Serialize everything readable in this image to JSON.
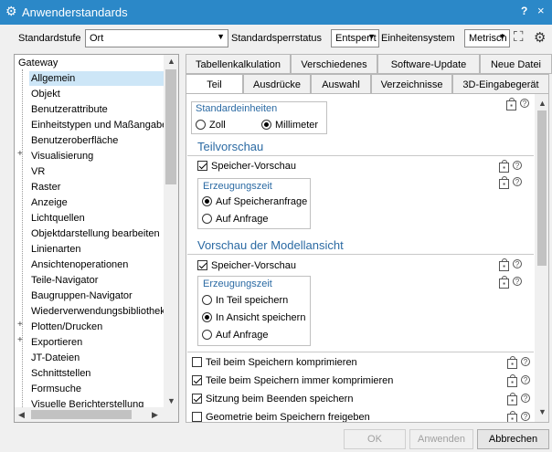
{
  "window": {
    "title": "Anwenderstandards",
    "help": "?",
    "close": "×"
  },
  "toolbar": {
    "level_label": "Standardstufe",
    "level_value": "Ort",
    "lock_label": "Standardsperrstatus",
    "lock_value": "Entsperrt",
    "units_label": "Einheitensystem",
    "units_value": "Metrisch"
  },
  "tree": {
    "items": [
      "Gateway",
      "Allgemein",
      "Objekt",
      "Benutzerattribute",
      "Einheitstypen und Maßangaber",
      "Benutzeroberfläche",
      "Visualisierung",
      "VR",
      "Raster",
      "Anzeige",
      "Lichtquellen",
      "Objektdarstellung bearbeiten",
      "Linienarten",
      "Ansichtenoperationen",
      "Teile-Navigator",
      "Baugruppen-Navigator",
      "Wiederverwendungsbibliothek",
      "Plotten/Drucken",
      "Exportieren",
      "JT-Dateien",
      "Schnittstellen",
      "Formsuche",
      "Visuelle Berichterstellung"
    ],
    "expanders": [
      "+",
      "+",
      "+"
    ]
  },
  "tabs_row1": [
    "Tabellenkalkulation",
    "Verschiedenes",
    "Software-Update",
    "Neue Datei"
  ],
  "tabs_row2": [
    "Teil",
    "Ausdrücke",
    "Auswahl",
    "Verzeichnisse",
    "3D-Eingabegerät"
  ],
  "panel": {
    "std_units": {
      "title": "Standardeinheiten",
      "opt1": "Zoll",
      "opt2": "Millimeter"
    },
    "part_preview": {
      "title": "Teilvorschau",
      "save_preview": "Speicher-Vorschau",
      "gen_title": "Erzeugungszeit",
      "opt1": "Auf Speicheranfrage",
      "opt2": "Auf Anfrage"
    },
    "model_preview": {
      "title": "Vorschau der Modellansicht",
      "save_preview": "Speicher-Vorschau",
      "gen_title": "Erzeugungszeit",
      "opt1": "In Teil speichern",
      "opt2": "In Ansicht speichern",
      "opt3": "Auf Anfrage"
    },
    "options": [
      "Teil beim Speichern komprimieren",
      "Teile beim Speichern immer komprimieren",
      "Sitzung beim Beenden speichern",
      "Geometrie beim Speichern freigeben"
    ],
    "lock_glyph": "⊡",
    "help_glyph": "?"
  },
  "buttons": {
    "ok": "OK",
    "apply": "Anwenden",
    "cancel": "Abbrechen"
  }
}
